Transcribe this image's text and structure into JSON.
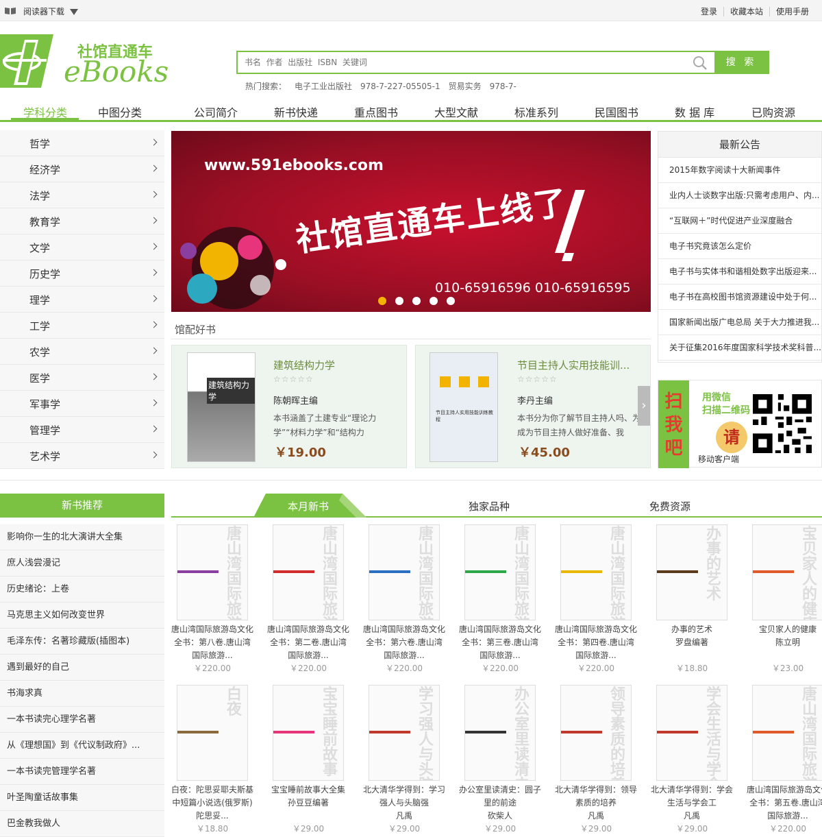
{
  "topbar": {
    "reader_download": "阅读器下载",
    "links": [
      "登录",
      "收藏本站",
      "使用手册"
    ]
  },
  "logo": {
    "cn": "社馆直通车",
    "en": "eBooks"
  },
  "search": {
    "placeholder": "书名  作者  出版社  ISBN  关键词",
    "button": "搜 索"
  },
  "hot": {
    "label": "热门搜索：",
    "terms": [
      "电子工业出版社",
      "978-7-227-05505-1",
      "贸易实务",
      "978-7-"
    ]
  },
  "nav": [
    "学科分类",
    "中图分类",
    "公司简介",
    "新书快递",
    "重点图书",
    "大型文献",
    "标准系列",
    "民国图书",
    "数 据 库",
    "已购资源"
  ],
  "sidebar": [
    "哲学",
    "经济学",
    "法学",
    "教育学",
    "文学",
    "历史学",
    "理学",
    "工学",
    "农学",
    "医学",
    "军事学",
    "管理学",
    "艺术学"
  ],
  "banner": {
    "url": "www.591ebooks.com",
    "slogan": "社馆直通车上线了",
    "phone": "010-65916596   010-65916595",
    "dots": 5,
    "active_dot": 0
  },
  "notice": {
    "title": "最新公告",
    "items": [
      "2015年数字阅读十大新闻事件",
      "业内人士谈数字出版:只需考虑用户、内...",
      "“互联网＋”时代促进产业深度融合",
      "电子书究竟该怎么定价",
      "电子书与实体书和谐相处数字出版迎来...",
      "电子书在高校图书馆资源建设中处于何...",
      "国家新闻出版广电总局 关于大力推进我...",
      "关于征集2016年度国家科学技术奖科普..."
    ]
  },
  "picks": {
    "title": "馆配好书",
    "books": [
      {
        "title": "建筑结构力学",
        "stars": "☆☆☆☆☆",
        "author": "陈朝晖主编",
        "desc": "本书涵盖了土建专业“理论力学”“材料力学”和“结构力",
        "price": "￥19.00",
        "cover_text": "建筑结构力学"
      },
      {
        "title": "节目主持人实用技能训...",
        "stars": "☆☆☆☆☆",
        "author": "李丹主编",
        "desc": "本书分为你了解节目主持人吗、为成为节目主持人做好准备、我",
        "price": "￥45.00",
        "cover_text": "节目主持人实用技能训练教程"
      }
    ]
  },
  "qr": {
    "side": "扫我吧",
    "line1": "用微信",
    "line2": "扫描二维码",
    "qing": "请",
    "line3": "移动客户端"
  },
  "newbooks": {
    "title": "新书推荐",
    "items": [
      "影响你一生的北大演讲大全集",
      "庶人浅尝漫记",
      "历史绪论：上卷",
      "马克思主义如何改变世界",
      "毛泽东传：名著珍藏版(插图本)",
      "遇到最好的自己",
      "书海求真",
      "一本书读完心理学名著",
      "从《理想国》到《代议制政府》...",
      "一本书读完管理学名著",
      "叶圣陶童话故事集",
      "巴金教我做人"
    ]
  },
  "tabs": [
    "本月新书",
    "独家品种",
    "免费资源"
  ],
  "grid": [
    {
      "name": "唐山湾国际旅游岛文化全书：第八卷.唐山湾国际旅游...",
      "author": "",
      "price": "￥220.00",
      "cover": "唐山湾国际旅游岛文化全书",
      "bar": "#8a3fa0"
    },
    {
      "name": "唐山湾国际旅游岛文化全书：第二卷.唐山湾国际旅游...",
      "author": "",
      "price": "￥220.00",
      "cover": "唐山湾国际旅游岛文化全书",
      "bar": "#d22b2b"
    },
    {
      "name": "唐山湾国际旅游岛文化全书：第六卷.唐山湾国际旅游...",
      "author": "",
      "price": "￥220.00",
      "cover": "唐山湾国际旅游岛文化全书",
      "bar": "#2b6fc2"
    },
    {
      "name": "唐山湾国际旅游岛文化全书：第三卷.唐山湾国际旅游...",
      "author": "",
      "price": "￥220.00",
      "cover": "唐山湾国际旅游岛文化全书",
      "bar": "#2ca84a"
    },
    {
      "name": "唐山湾国际旅游岛文化全书：第四卷.唐山湾国际旅游...",
      "author": "",
      "price": "￥220.00",
      "cover": "唐山湾国际旅游岛文化全书",
      "bar": "#e8b800"
    },
    {
      "name": "办事的艺术",
      "author": "罗盘编著",
      "price": "￥18.80",
      "cover": "办事的艺术",
      "bar": "#5a3a1a"
    },
    {
      "name": "宝贝家人的健康",
      "author": "陈立明",
      "price": "￥23.00",
      "cover": "宝贝家人的健康",
      "bar": "#e05a2a"
    },
    {
      "name": "白夜：陀思妥耶夫斯基中短篇小说选(俄罗斯) 陀思妥...",
      "author": "",
      "price": "￥18.80",
      "cover": "白夜",
      "bar": "#8a6a3a"
    },
    {
      "name": "宝宝睡前故事大全集",
      "author": "孙豆豆编著",
      "price": "￥29.00",
      "cover": "宝宝睡前故事",
      "bar": "#e8347a"
    },
    {
      "name": "北大清华学得到：学习强人与头脑强",
      "author": "凡禹",
      "price": "￥29.00",
      "cover": "学习强人与头脑强人",
      "bar": "#c0392b"
    },
    {
      "name": "办公室里读清史：圆子里的前途",
      "author": "砍柴人",
      "price": "￥29.00",
      "cover": "办公室里读清史",
      "bar": "#333333"
    },
    {
      "name": "北大清华学得到：领导素质的培养",
      "author": "凡禹",
      "price": "￥29.00",
      "cover": "领导素质的培养",
      "bar": "#c0392b"
    },
    {
      "name": "北大清华学得到：学会生活与学会工",
      "author": "凡禹",
      "price": "￥29.00",
      "cover": "学会生活与学会工作",
      "bar": "#c0392b"
    },
    {
      "name": "唐山湾国际旅游岛文化全书：第五卷.唐山湾国际旅游...",
      "author": "",
      "price": "￥220.00",
      "cover": "唐山湾国际旅游岛文化全书",
      "bar": "#e05a2a"
    }
  ]
}
